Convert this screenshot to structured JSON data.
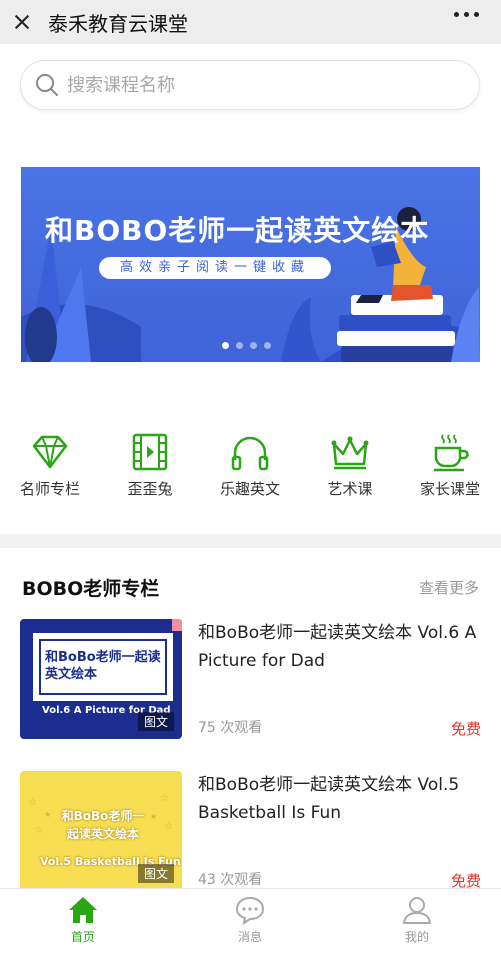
{
  "topbar": {
    "title": "泰禾教育云课堂"
  },
  "search": {
    "placeholder": "搜索课程名称"
  },
  "banner": {
    "title": "和BOBO老师一起读英文绘本",
    "subtitle": "高效亲子阅读一键收藏",
    "dots": 4,
    "active_dot": 0
  },
  "categories": [
    {
      "label": "名师专栏",
      "icon": "diamond-icon"
    },
    {
      "label": "歪歪兔",
      "icon": "film-icon"
    },
    {
      "label": "乐趣英文",
      "icon": "headphones-icon"
    },
    {
      "label": "艺术课",
      "icon": "crown-icon"
    },
    {
      "label": "家长课堂",
      "icon": "coffee-cup-icon"
    }
  ],
  "section": {
    "title": "BOBO老师专栏",
    "more": "查看更多"
  },
  "courses": [
    {
      "title": "和BoBo老师一起读英文绘本 Vol.6 A Picture for Dad",
      "views": "75 次观看",
      "price": "免费",
      "tag": "图文",
      "thumb_title": "和BoBo老师一起读英文绘本",
      "thumb_sub": "Vol.6 A Picture for Dad"
    },
    {
      "title": "和BoBo老师一起读英文绘本 Vol.5 Basketball Is Fun",
      "views": "43 次观看",
      "price": "免费",
      "tag": "图文",
      "thumb_title": "和BoBo老师一起读英文绘本",
      "thumb_sub": "Vol.5 Basketball Is Fun"
    }
  ],
  "tabs": [
    {
      "label": "首页",
      "icon": "home-icon",
      "active": true
    },
    {
      "label": "消息",
      "icon": "message-icon",
      "active": false
    },
    {
      "label": "我的",
      "icon": "user-icon",
      "active": false
    }
  ],
  "colors": {
    "accent_green": "#2aa515",
    "price_red": "#e5322d",
    "banner_blue": "#4a74e6"
  }
}
